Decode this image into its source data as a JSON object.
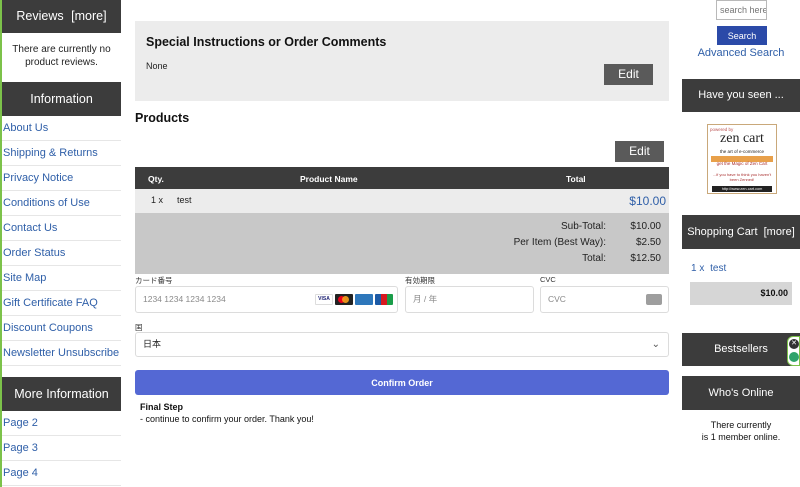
{
  "left": {
    "reviews": {
      "title": "Reviews",
      "more": "[more]",
      "body": "There are currently no product reviews."
    },
    "information": {
      "title": "Information",
      "items": [
        "About Us",
        "Shipping & Returns",
        "Privacy Notice",
        "Conditions of Use",
        "Contact Us",
        "Order Status",
        "Site Map",
        "Gift Certificate FAQ",
        "Discount Coupons",
        "Newsletter Unsubscribe"
      ]
    },
    "more_info": {
      "title": "More Information",
      "items": [
        "Page 2",
        "Page 3",
        "Page 4"
      ]
    }
  },
  "instructions": {
    "title": "Special Instructions or Order Comments",
    "text": "None",
    "edit_label": "Edit"
  },
  "products": {
    "title": "Products",
    "edit_label": "Edit",
    "headers": {
      "qty": "Qty.",
      "name": "Product Name",
      "total": "Total"
    },
    "rows": [
      {
        "qty": "1 x",
        "name": "test",
        "price": "$10.00"
      }
    ],
    "totals": [
      {
        "label": "Sub-Total:",
        "value": "$10.00"
      },
      {
        "label": "Per Item (Best Way):",
        "value": "$2.50"
      },
      {
        "label": "Total:",
        "value": "$12.50"
      }
    ]
  },
  "payment": {
    "card_label": "カード番号",
    "card_placeholder": "1234 1234 1234 1234",
    "expiry_label": "有効期限",
    "expiry_placeholder": "月 / 年",
    "cvc_label": "CVC",
    "cvc_placeholder": "CVC",
    "country_label": "国",
    "country_value": "日本",
    "card_brands": [
      "visa",
      "mastercard",
      "amex",
      "jcb"
    ]
  },
  "confirm_label": "Confirm Order",
  "final": {
    "title": "Final Step",
    "text": "- continue to confirm your order. Thank you!"
  },
  "right": {
    "search_placeholder": "search here",
    "search_button": "Search",
    "advanced_search": "Advanced Search",
    "have_you_seen": "Have you seen ...",
    "zencart_logo": {
      "top": "powered by",
      "main": "zen cart",
      "sub": "the art of e-commerce",
      "tag": "get the Magic of Zen Cart",
      "tag2": "...if you have to think you haven't been Zenned!",
      "url": "http://www.zen-cart.com"
    },
    "cart": {
      "title": "Shopping Cart",
      "more": "[more]",
      "item_qty": "1 x",
      "item_name": "test",
      "total": "$10.00"
    },
    "bestsellers": "Bestsellers",
    "whos_online": {
      "title": "Who's Online",
      "line1": "There currently",
      "line2": "is 1 member online."
    }
  },
  "colors": {
    "header_bg": "#3c3c3c",
    "link": "#2f5fa8",
    "confirm": "#5468d4",
    "accent_border": "#7cc24a"
  }
}
